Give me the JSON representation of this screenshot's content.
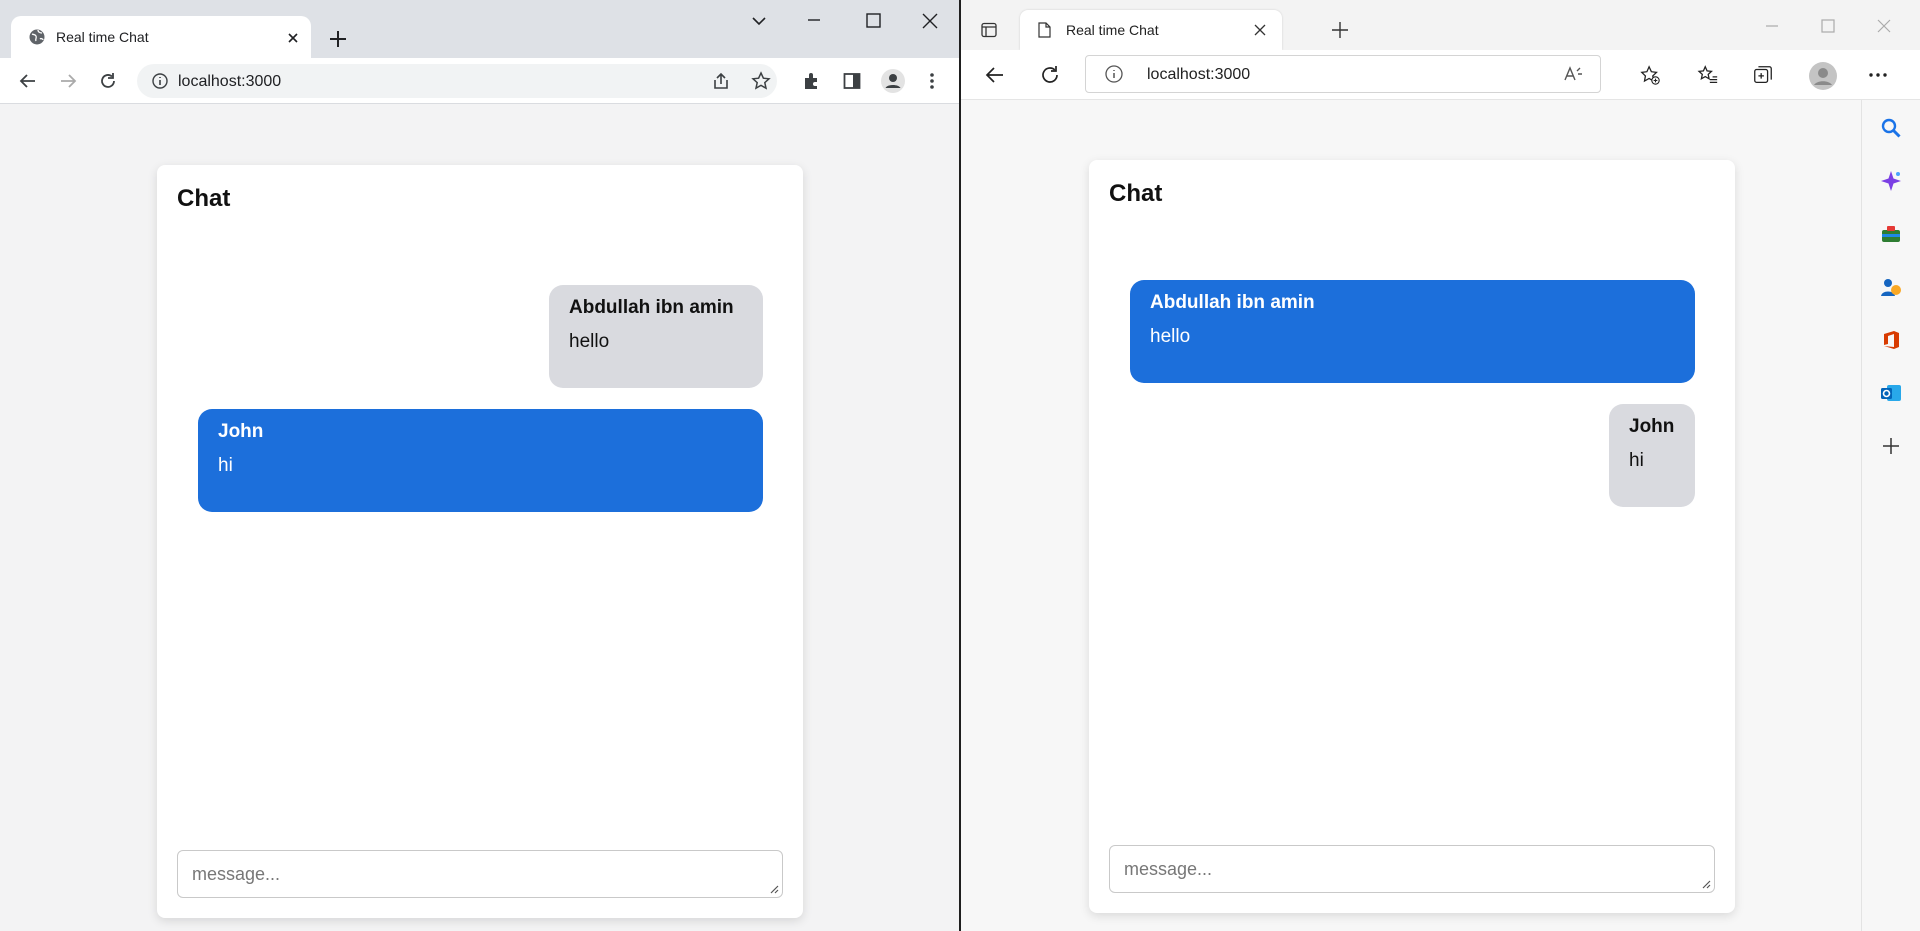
{
  "left": {
    "tab_title": "Real time Chat",
    "url": "localhost:3000",
    "chat": {
      "title": "Chat",
      "messages": [
        {
          "name": "Abdullah ibn amin",
          "text": "hello",
          "style": "received"
        },
        {
          "name": "John",
          "text": "hi",
          "style": "sent"
        }
      ],
      "input_placeholder": "message..."
    }
  },
  "right": {
    "tab_title": "Real time Chat",
    "url": "localhost:3000",
    "chat": {
      "title": "Chat",
      "messages": [
        {
          "name": "Abdullah ibn amin",
          "text": "hello",
          "style": "sent"
        },
        {
          "name": "John",
          "text": "hi",
          "style": "received"
        }
      ],
      "input_placeholder": "message..."
    }
  },
  "colors": {
    "sent_bubble": "#1c6fdb",
    "received_bubble": "#d9dadf",
    "page_bg": "#f3f3f4"
  }
}
